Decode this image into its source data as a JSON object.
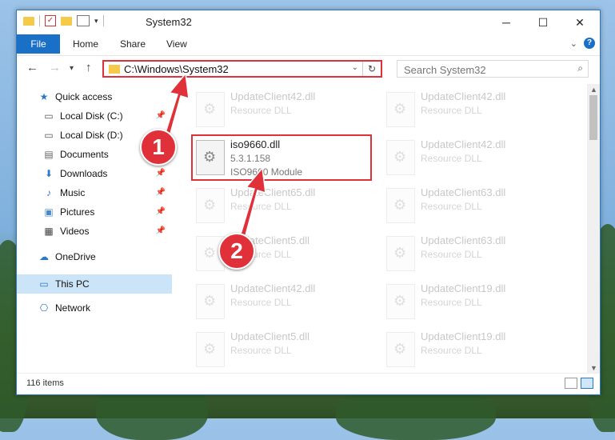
{
  "window": {
    "title": "System32",
    "controls": {
      "minimize": "─",
      "maximize": "☐",
      "close": "✕"
    }
  },
  "ribbon": {
    "tabs": [
      "File",
      "Home",
      "Share",
      "View"
    ],
    "expand_icon": "chevron-down-icon",
    "help_label": "?"
  },
  "address": {
    "path": "C:\\Windows\\System32",
    "refresh_icon": "↻"
  },
  "search": {
    "placeholder": "Search System32"
  },
  "nav": {
    "items": [
      {
        "label": "Quick access",
        "icon": "star-icon"
      },
      {
        "label": "Local Disk (C:)",
        "icon": "drive-icon",
        "pinned": true
      },
      {
        "label": "Local Disk (D:)",
        "icon": "drive-icon",
        "pinned": true
      },
      {
        "label": "Documents",
        "icon": "documents-icon",
        "pinned": true
      },
      {
        "label": "Downloads",
        "icon": "download-icon",
        "pinned": true
      },
      {
        "label": "Music",
        "icon": "music-icon",
        "pinned": true
      },
      {
        "label": "Pictures",
        "icon": "pictures-icon",
        "pinned": true
      },
      {
        "label": "Videos",
        "icon": "videos-icon",
        "pinned": true
      },
      {
        "label": "OneDrive",
        "icon": "cloud-icon"
      },
      {
        "label": "This PC",
        "icon": "computer-icon",
        "selected": true
      },
      {
        "label": "Network",
        "icon": "network-icon"
      }
    ]
  },
  "files": {
    "left": [
      {
        "name": "UpdateClient42.dll",
        "desc": "Resource DLL"
      },
      {
        "name": "iso9660.dll",
        "version": "5.3.1.158",
        "desc": "ISO9660 Module"
      },
      {
        "name": "UpdateClient65.dll",
        "desc": "Resource DLL"
      },
      {
        "name": "UpdateClient5.dll",
        "desc": "Resource DLL"
      },
      {
        "name": "UpdateClient42.dll",
        "desc": "Resource DLL"
      },
      {
        "name": "UpdateClient5.dll",
        "desc": "Resource DLL"
      }
    ],
    "right": [
      {
        "name": "UpdateClient42.dll",
        "desc": "Resource DLL"
      },
      {
        "name": "UpdateClient42.dll",
        "desc": "Resource DLL"
      },
      {
        "name": "UpdateClient63.dll",
        "desc": "Resource DLL"
      },
      {
        "name": "UpdateClient63.dll",
        "desc": "Resource DLL"
      },
      {
        "name": "UpdateClient19.dll",
        "desc": "Resource DLL"
      },
      {
        "name": "UpdateClient19.dll",
        "desc": "Resource DLL"
      }
    ]
  },
  "status": {
    "count": "116 items"
  },
  "annotations": {
    "step1": "1",
    "step2": "2",
    "color": "#e0313a"
  }
}
